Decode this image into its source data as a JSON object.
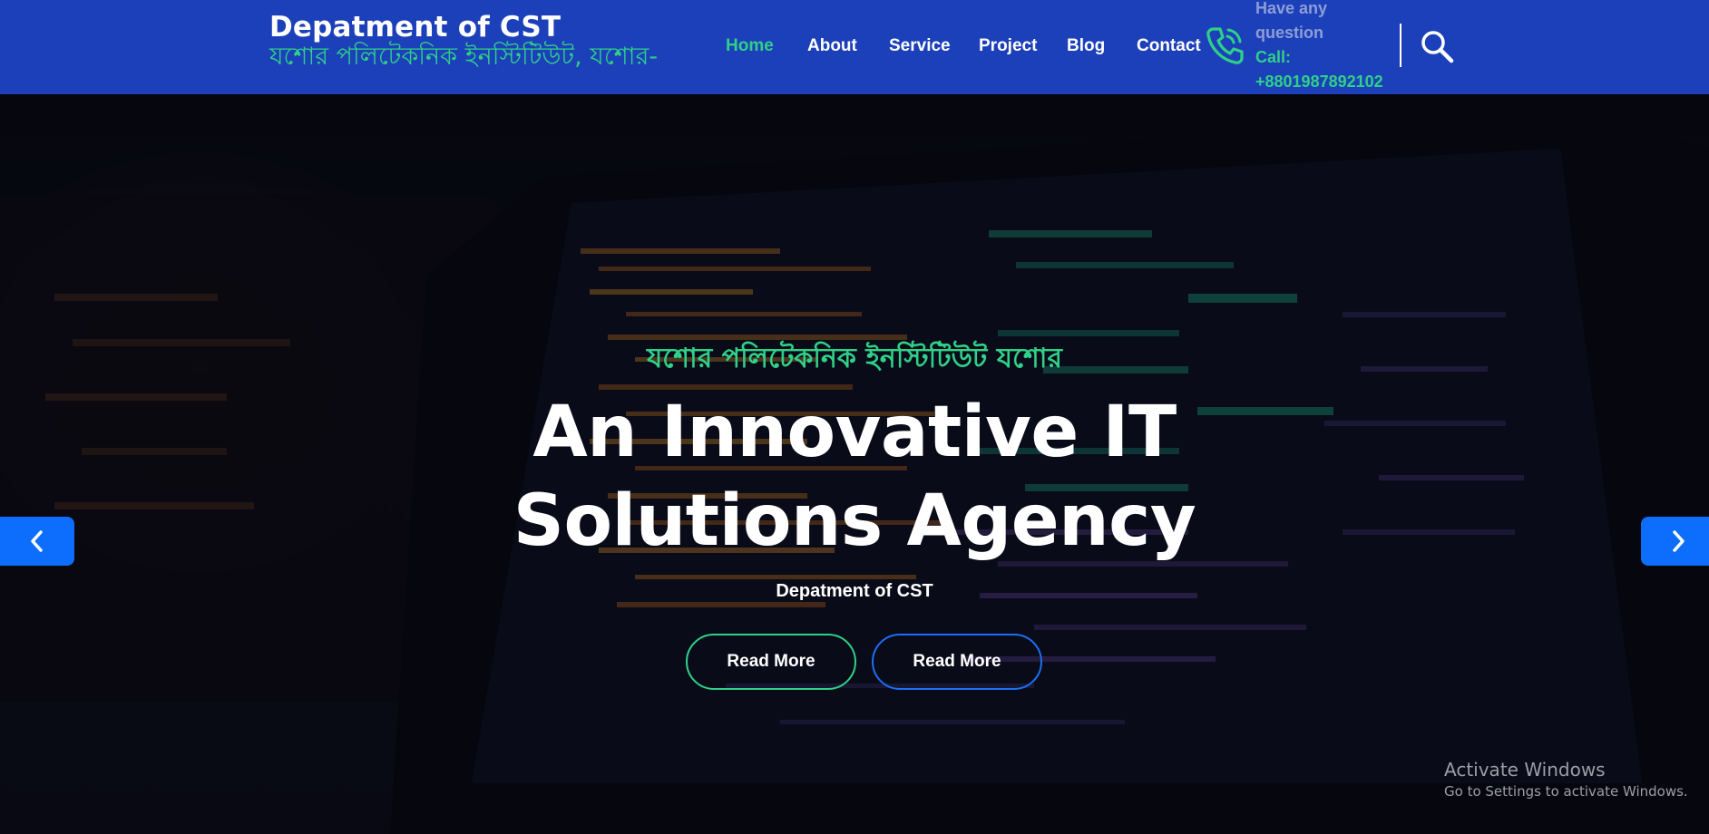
{
  "colors": {
    "navbar_bg": "#1c40b9",
    "accent_green": "#2fd088",
    "accent_blue": "#0d6efd",
    "text_white": "#ffffff"
  },
  "header": {
    "brand_title": "Depatment of CST",
    "brand_subtitle": "যশোর পলিটেকনিক ইনস্টিটিউট, যশোর-"
  },
  "nav": {
    "items": [
      {
        "label": "Home",
        "active": true
      },
      {
        "label": "About",
        "active": false
      },
      {
        "label": "Service",
        "active": false
      },
      {
        "label": "Project",
        "active": false
      },
      {
        "label": "Blog",
        "active": false
      },
      {
        "label": "Contact",
        "active": false
      }
    ]
  },
  "contact": {
    "icon": "phone-icon",
    "question": "Have any question",
    "call": "Call: +8801987892102"
  },
  "search": {
    "icon": "search-icon"
  },
  "hero": {
    "tagline": "যশোর পলিটেকনিক ইনস্টিটিউট যশোর",
    "title": "An Innovative IT Solutions Agency",
    "subtitle": "Depatment of CST",
    "buttons": [
      "Read More",
      "Read More"
    ],
    "prev_icon": "chevron-left-icon",
    "next_icon": "chevron-right-icon"
  },
  "watermark": {
    "title": "Activate Windows",
    "subtitle": "Go to Settings to activate Windows."
  }
}
